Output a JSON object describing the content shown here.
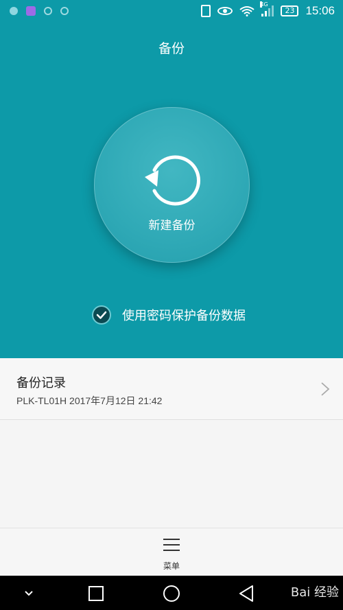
{
  "status_bar": {
    "left_icons": [
      "notification-dot-icon",
      "gallery-icon",
      "shield-icon",
      "circle-icon"
    ],
    "network": "4G",
    "battery": "23",
    "time": "15:06"
  },
  "header": {
    "title": "备份"
  },
  "new_backup": {
    "label": "新建备份",
    "icon": "refresh-icon"
  },
  "password_option": {
    "label": "使用密码保护备份数据",
    "checked": true
  },
  "records": {
    "title": "备份记录",
    "subtitle": "PLK-TL01H  2017年7月12日 21:42"
  },
  "menu": {
    "label": "菜单",
    "icon": "hamburger-icon"
  },
  "navbar": {
    "items": [
      "collapse-icon",
      "recent-apps-icon",
      "home-icon",
      "back-icon"
    ]
  },
  "watermark": "Bai 经验",
  "colors": {
    "accent": "#0d9aa8",
    "circle": "#2fa9b6",
    "checkbox": "#0b4a52"
  }
}
